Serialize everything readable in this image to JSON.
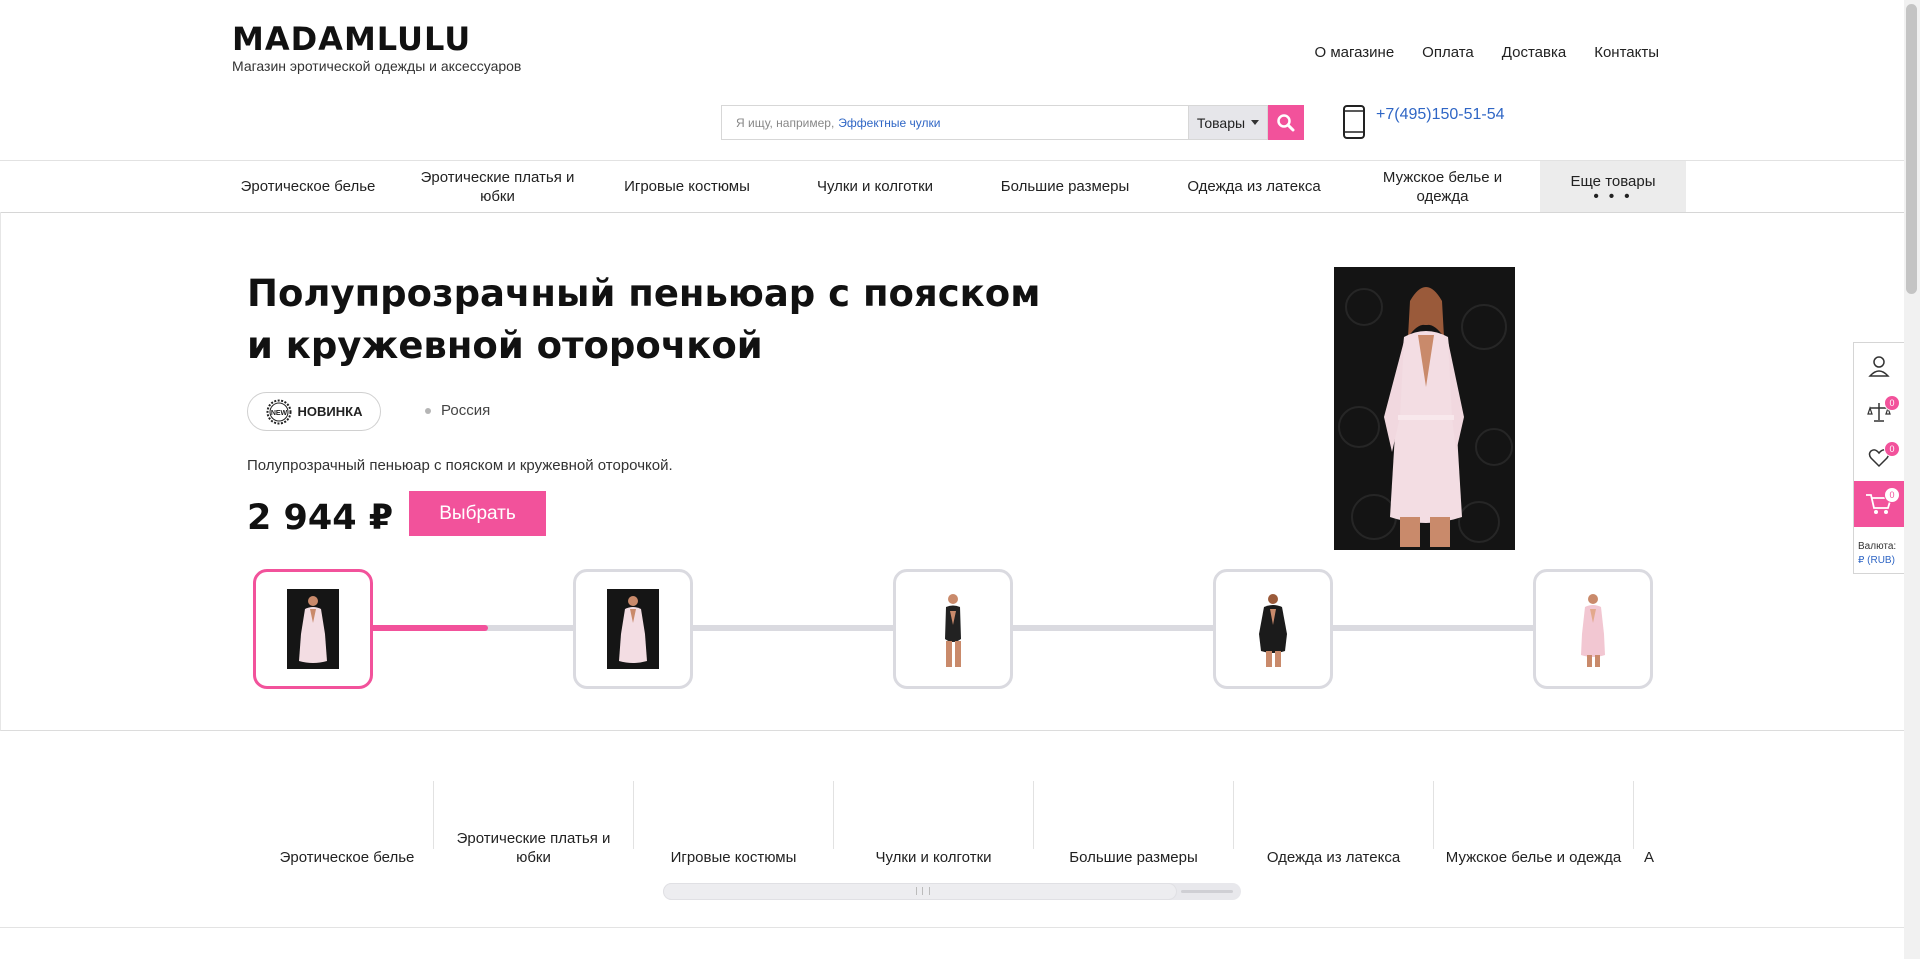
{
  "header": {
    "logo": "MADAMLULU",
    "tagline": "Магазин эротической одежды и аксессуаров",
    "nav": [
      "О магазине",
      "Оплата",
      "Доставка",
      "Контакты"
    ]
  },
  "search": {
    "placeholder_prefix": "Я ищу, например,",
    "placeholder_hint": "Эффектные чулки",
    "scope": "Товары",
    "icon": "search-icon"
  },
  "phone": {
    "number": "+7(495)150-51-54",
    "icon": "mobile-phone-icon"
  },
  "categories": [
    "Эротическое белье",
    "Эротические платья и юбки",
    "Игровые костюмы",
    "Чулки и колготки",
    "Большие размеры",
    "Одежда из латекса",
    "Мужское белье и одежда"
  ],
  "more": {
    "label": "Еще товары",
    "dots": "• • •"
  },
  "product": {
    "title": "Полупрозрачный пеньюар с пояском и кружевной оторочкой",
    "badge": "НОВИНКА",
    "badge_icon_text": "NEW",
    "country": "Россия",
    "description": "Полупрозрачный пеньюар с пояском и кружевной оторочкой.",
    "price": "2 944 ₽",
    "button": "Выбрать"
  },
  "slider": {
    "progress": 0.15,
    "active_index": 0
  },
  "lower_categories": [
    "Эротическое белье",
    "Эротические платья и юбки",
    "Игровые костюмы",
    "Чулки и колготки",
    "Большие размеры",
    "Одежда из латекса",
    "Мужское белье и одежда",
    "А"
  ],
  "side_panel": {
    "compare_count": "0",
    "favorites_count": "0",
    "cart_count": "0",
    "currency_label": "Валюта:",
    "currency_value": "₽ (RUB)"
  },
  "colors": {
    "accent": "#f2529b",
    "link": "#2f66c5"
  }
}
